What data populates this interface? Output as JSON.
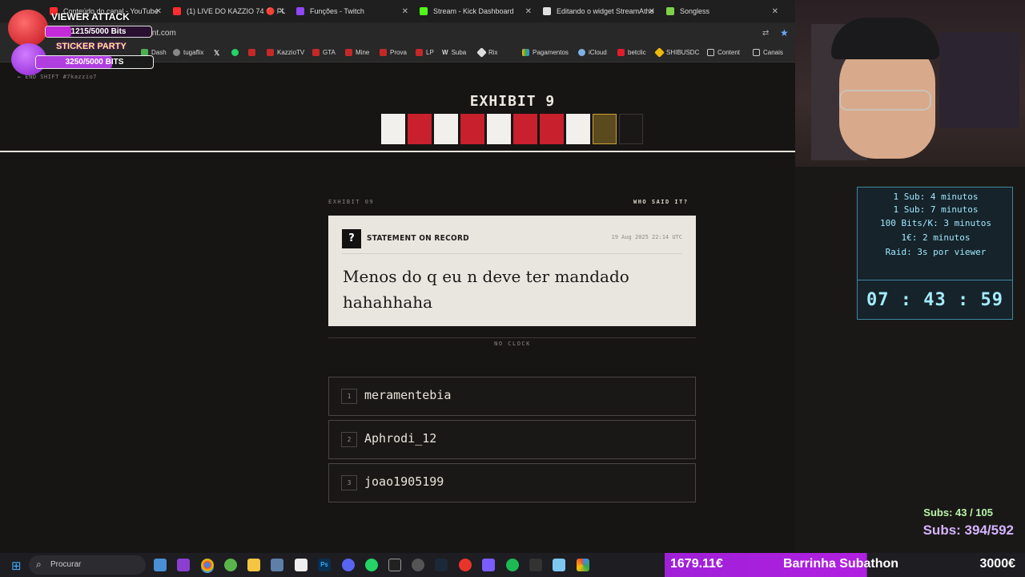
{
  "browser": {
    "tabs": [
      {
        "label": "Conteúdo do canal - YouTube",
        "color": "#ff2d2d"
      },
      {
        "label": "(1) LIVE DO KAZZIO 74 🔴 FU",
        "color": "#ff2d2d"
      },
      {
        "label": "Funções - Twitch",
        "color": "#9146ff"
      },
      {
        "label": "Stream - Kick Dashboard",
        "color": "#53fc18"
      },
      {
        "label": "Editando o widget StreamAthe",
        "color": "#e0e0e0"
      },
      {
        "label": "Songless",
        "color": "#7fd14a"
      }
    ],
    "url": "aint.com",
    "bookmarks": [
      "Dash",
      "tugaflix",
      "KazzioTV",
      "GTA",
      "Mine",
      "Prova",
      "LP",
      "Suba",
      "Rix",
      "Pagamentos",
      "iCloud",
      "betclic",
      "SHIBUSDC",
      "Content",
      "Canais"
    ]
  },
  "page": {
    "end_shift": "← END SHIFT   #7kazzio7",
    "exhibit_title": "EXHIBIT 9",
    "squares": [
      "white",
      "red",
      "white",
      "red",
      "white",
      "red",
      "red",
      "white",
      "gold",
      "empty"
    ],
    "section_label": "EXHIBIT 09",
    "who_said": "WHO SAID IT?",
    "card": {
      "badge": "?",
      "label": "STATEMENT ON RECORD",
      "date": "19 Aug 2025 22:14 UTC",
      "quote": "Menos do q eu n deve ter mandado hahahhaha"
    },
    "no_clock": "NO CLOCK",
    "answers": [
      {
        "num": "1",
        "name": "meramentebia"
      },
      {
        "num": "2",
        "name": "Aphrodi_12"
      },
      {
        "num": "3",
        "name": "joao1905199"
      }
    ]
  },
  "overlay": {
    "alert_viewer_attack": "VIEWER ATTACK",
    "bits_1": "1215/5000 Bits",
    "bits_1_progress": 0.243,
    "alert_sticker_party": "STICKER PARTY",
    "bits_2": "3250/5000 BITS",
    "bits_2_progress": 0.65,
    "info_lines": [
      "1 Sub: 4 minutos",
      "1 Sub: 7 minutos",
      "100 Bits/K: 3 minutos",
      "1€: 2 minutos",
      "Raid: 3s por viewer"
    ],
    "timer": "07 : 43 : 59",
    "subs_1": "Subs: 43 / 105",
    "subs_2": "Subs: 394/592",
    "subathon_current": "1679.11€",
    "subathon_label": "Barrinha Subathon",
    "subathon_goal": "3000€",
    "subathon_progress": 0.56
  },
  "taskbar": {
    "search_placeholder": "Procurar"
  }
}
